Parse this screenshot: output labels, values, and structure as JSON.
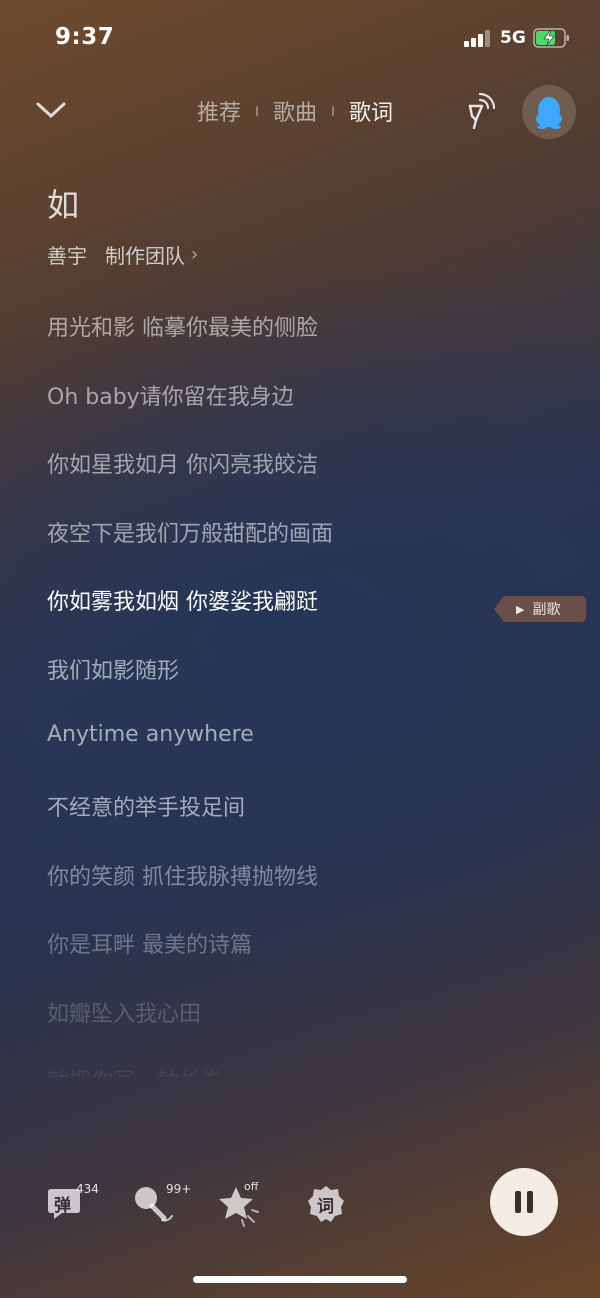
{
  "status_bar": {
    "time": "9:37",
    "network": "5G"
  },
  "header": {
    "tabs": [
      {
        "label": "推荐",
        "active": false
      },
      {
        "label": "歌曲",
        "active": false
      },
      {
        "label": "歌词",
        "active": true
      }
    ]
  },
  "song": {
    "title": "如",
    "singer": "善宇",
    "team_link": "制作团队"
  },
  "lyrics": [
    {
      "text": "用光和影 临摹你最美的侧脸",
      "tone": "past"
    },
    {
      "text": "Oh baby请你留在我身边",
      "tone": "past"
    },
    {
      "text": "你如星我如月 你闪亮我皎洁",
      "tone": "past"
    },
    {
      "text": "夜空下是我们万般甜配的画面",
      "tone": "past"
    },
    {
      "text": "你如雾我如烟 你婆娑我翩跹",
      "tone": "current"
    },
    {
      "text": "我们如影随形",
      "tone": "next"
    },
    {
      "text": "Anytime anywhere",
      "tone": "next"
    },
    {
      "text": "不经意的举手投足间",
      "tone": "next"
    },
    {
      "text": "你的笑颜 抓住我脉搏抛物线",
      "tone": "fade1"
    },
    {
      "text": "你是耳畔 最美的诗篇",
      "tone": "fade2"
    },
    {
      "text": "如瓣坠入我心田",
      "tone": "fade3"
    },
    {
      "text": "就把你写一轴长卷",
      "tone": "fade4"
    }
  ],
  "chorus_tag": "副歌",
  "toolbar": {
    "danmu_label": "弹",
    "danmu_count": "434",
    "mic_count": "99+",
    "star_state": "off",
    "lyric_label": "词"
  },
  "icons": {
    "collapse": "chevron-down-icon",
    "cast": "cast-icon",
    "avatar": "penguin-icon",
    "pause": "pause-icon"
  },
  "colors": {
    "accent_avatar": "#3fa7ff",
    "pause_bg": "#f4ece4"
  }
}
